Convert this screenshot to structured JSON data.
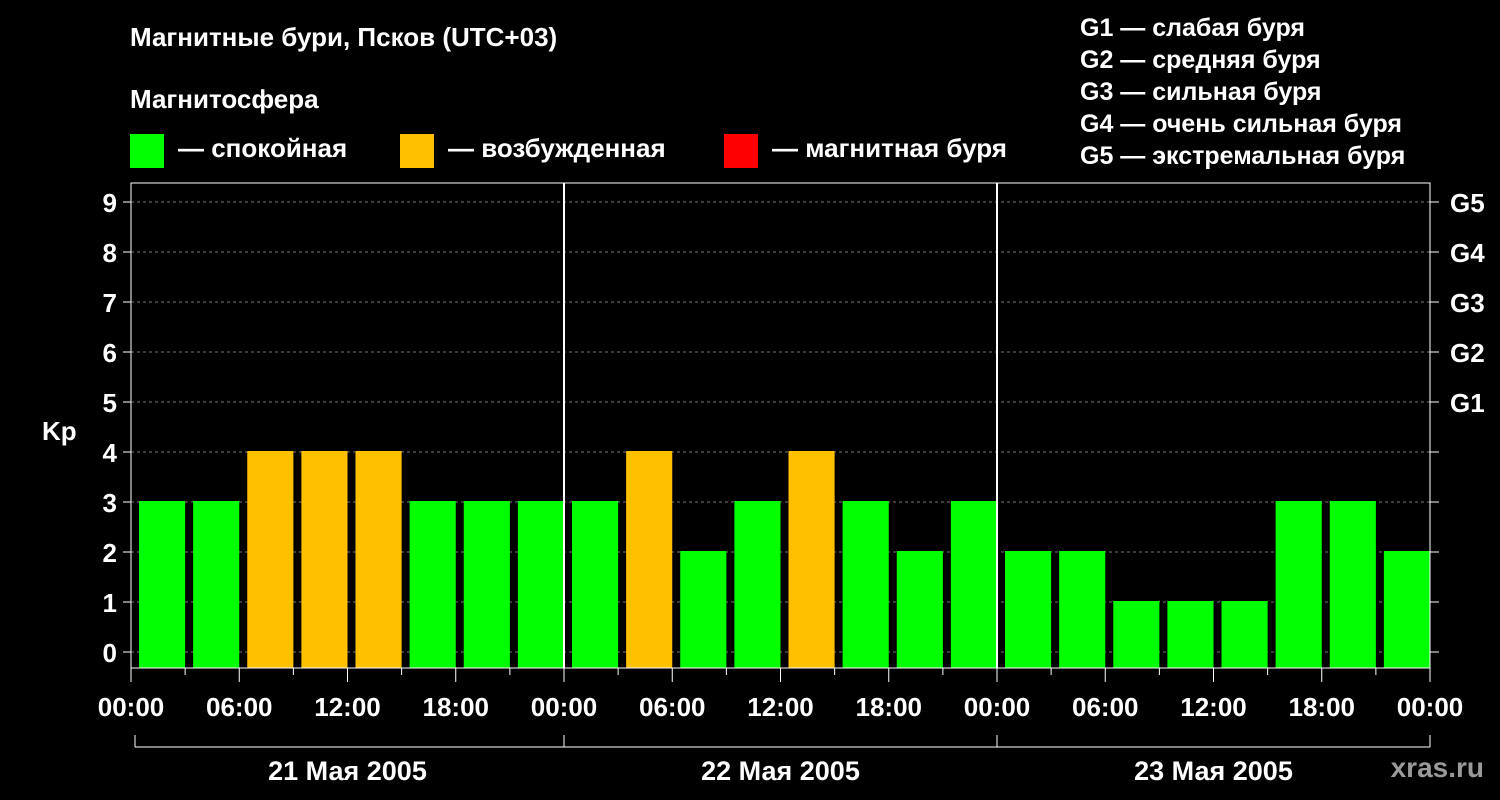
{
  "title": "Магнитные бури, Псков (UTC+03)",
  "magnetosphere_title": "Магнитосфера",
  "legend": [
    {
      "label": "— спокойная",
      "color": "#00ff00"
    },
    {
      "label": "— возбужденная",
      "color": "#ffc000"
    },
    {
      "label": "— магнитная буря",
      "color": "#ff0000"
    }
  ],
  "g_legend": [
    "G1 — слабая буря",
    "G2 — средняя буря",
    "G3 — сильная буря",
    "G4 — очень сильная буря",
    "G5 — экстремальная буря"
  ],
  "watermark": "xras.ru",
  "chart_data": {
    "type": "bar",
    "ylabel": "Kp",
    "ylim": [
      0,
      9
    ],
    "y_ticks": [
      "0",
      "1",
      "2",
      "3",
      "4",
      "5",
      "6",
      "7",
      "8",
      "9"
    ],
    "right_axis_labels": [
      {
        "value": 5,
        "label": "G1"
      },
      {
        "value": 6,
        "label": "G2"
      },
      {
        "value": 7,
        "label": "G3"
      },
      {
        "value": 8,
        "label": "G4"
      },
      {
        "value": 9,
        "label": "G5"
      }
    ],
    "x_tick_labels": [
      "00:00",
      "06:00",
      "12:00",
      "18:00",
      "00:00",
      "06:00",
      "12:00",
      "18:00",
      "00:00",
      "06:00",
      "12:00",
      "18:00",
      "00:00"
    ],
    "days": [
      "21 Мая 2005",
      "22 Мая 2005",
      "23 Мая 2005"
    ],
    "interval_hours": 3,
    "values": [
      3,
      3,
      4,
      4,
      4,
      3,
      3,
      3,
      3,
      4,
      2,
      3,
      4,
      3,
      2,
      3,
      2,
      2,
      1,
      1,
      1,
      3,
      3,
      2
    ],
    "colors": {
      "quiet": "#00ff00",
      "active": "#ffc000",
      "storm": "#ff0000"
    },
    "grid": true
  }
}
